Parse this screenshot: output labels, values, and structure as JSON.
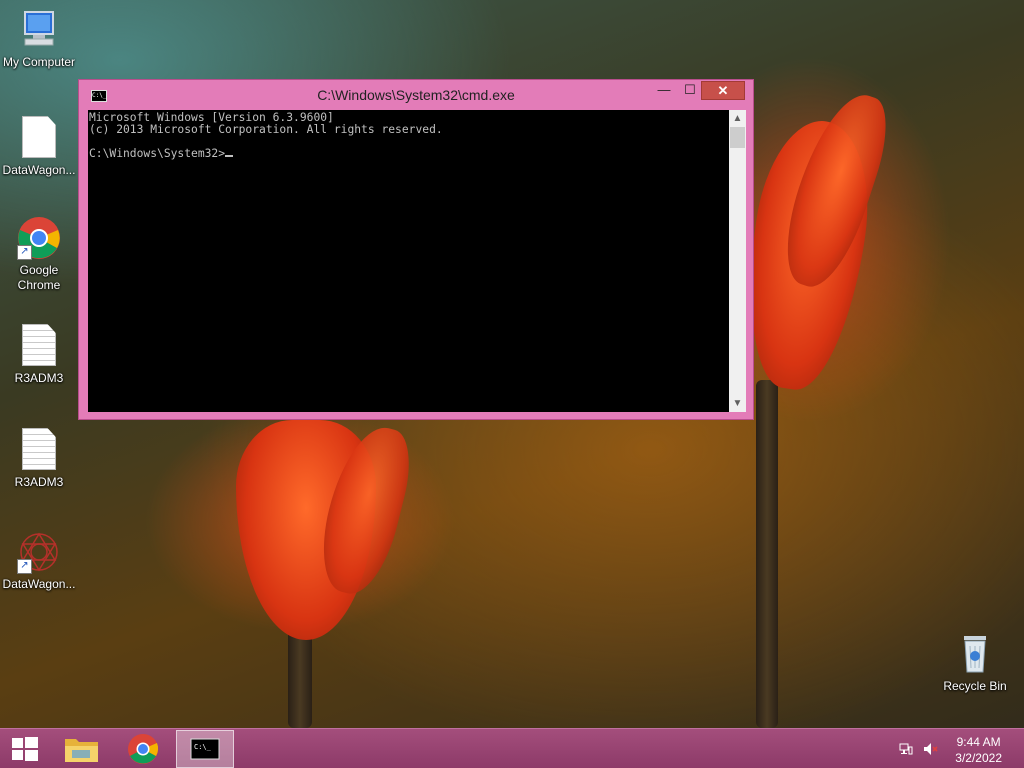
{
  "desktop": {
    "icons": [
      {
        "label": "My Computer",
        "icon": "computer-icon"
      },
      {
        "label": "DataWagon...",
        "icon": "document-icon"
      },
      {
        "label": "Google\nChrome",
        "icon": "chrome-icon"
      },
      {
        "label": "R3ADM3",
        "icon": "text-document-icon"
      },
      {
        "label": "R3ADM3",
        "icon": "text-document-icon"
      },
      {
        "label": "DataWagon...",
        "icon": "datawagon-logo-icon"
      },
      {
        "label": "Recycle Bin",
        "icon": "recycle-bin-icon"
      }
    ]
  },
  "window": {
    "title": "C:\\Windows\\System32\\cmd.exe",
    "minimize_glyph": "—",
    "maximize_glyph": "☐",
    "close_glyph": "✕",
    "console_lines": [
      "Microsoft Windows [Version 6.3.9600]",
      "(c) 2013 Microsoft Corporation. All rights reserved.",
      "",
      "C:\\Windows\\System32>"
    ]
  },
  "taskbar": {
    "time": "9:44 AM",
    "date": "3/2/2022",
    "items": [
      "start-button",
      "file-explorer",
      "google-chrome",
      "command-prompt"
    ],
    "active_item": "command-prompt"
  },
  "colors": {
    "window_frame": "#e37cb8",
    "close_button": "#c7504a",
    "taskbar": "#94426f",
    "console_bg": "#000000",
    "console_text": "#c0c0c0"
  }
}
